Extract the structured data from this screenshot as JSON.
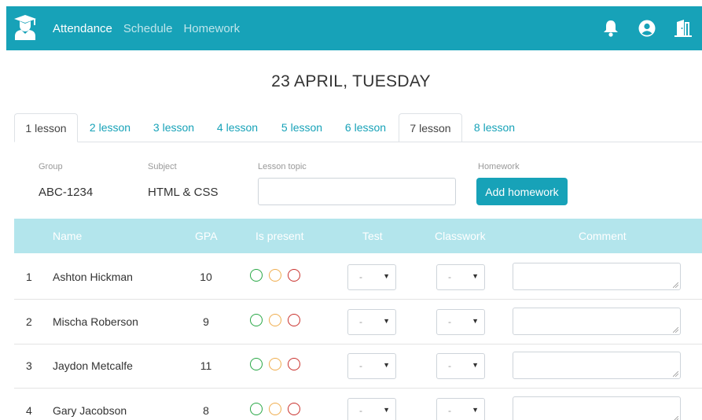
{
  "navbar": {
    "links": [
      "Attendance",
      "Schedule",
      "Homework"
    ],
    "active_link": "Attendance",
    "icons": [
      "notification-bell-icon",
      "user-account-icon",
      "logout-door-icon"
    ],
    "brand_color": "#17a2b8"
  },
  "page": {
    "title": "23 APRIL, TUESDAY"
  },
  "tabs": [
    "1 lesson",
    "2 lesson",
    "3 lesson",
    "4 lesson",
    "5 lesson",
    "6 lesson",
    "7 lesson",
    "8 lesson"
  ],
  "active_tab": "1 lesson",
  "form": {
    "group_label": "Group",
    "group_value": "ABC-1234",
    "subject_label": "Subject",
    "subject_value": "HTML & CSS",
    "topic_label": "Lesson topic",
    "topic_value": "",
    "homework_label": "Homework",
    "homework_button": "Add homework"
  },
  "table": {
    "headers": [
      "Name",
      "GPA",
      "Is present",
      "Test",
      "Classwork",
      "Comment"
    ],
    "rows": [
      {
        "num": "1",
        "name": "Ashton Hickman",
        "gpa": "10",
        "test": "-",
        "classwork": "-",
        "comment": ""
      },
      {
        "num": "2",
        "name": "Mischa Roberson",
        "gpa": "9",
        "test": "-",
        "classwork": "-",
        "comment": ""
      },
      {
        "num": "3",
        "name": "Jaydon Metcalfe",
        "gpa": "11",
        "test": "-",
        "classwork": "-",
        "comment": ""
      },
      {
        "num": "4",
        "name": "Gary Jacobson",
        "gpa": "8",
        "test": "-",
        "classwork": "-",
        "comment": ""
      }
    ],
    "presence_colors": [
      "#28a745",
      "#f0ad4e",
      "#c9302c"
    ]
  }
}
